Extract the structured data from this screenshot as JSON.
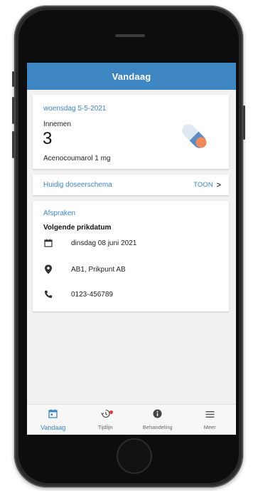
{
  "app": {
    "title": "Vandaag",
    "accent_color": "#3e86c1"
  },
  "today_card": {
    "date": "woensdag 5-5-2021",
    "take_label": "Innemen",
    "dose_count": "3",
    "medication": "Acenocoumarol 1 mg",
    "icon": "pill-capsule-icon"
  },
  "schema_card": {
    "label": "Huidig doseerschema",
    "action": "TOON",
    "chevron": ">"
  },
  "appointments_card": {
    "title": "Afspraken",
    "next_label": "Volgende prikdatum",
    "rows": [
      {
        "icon": "calendar-icon",
        "text": "dinsdag 08 juni 2021"
      },
      {
        "icon": "location-pin-icon",
        "text": "AB1, Prikpunt AB"
      },
      {
        "icon": "phone-icon",
        "text": "0123-456789"
      }
    ]
  },
  "bottom_nav": {
    "items": [
      {
        "label": "Vandaag",
        "icon": "calendar-icon",
        "active": true
      },
      {
        "label": "Tijdlijn",
        "icon": "history-icon",
        "active": false,
        "badge": true
      },
      {
        "label": "Behandeling",
        "icon": "info-icon",
        "active": false
      },
      {
        "label": "Meer",
        "icon": "menu-icon",
        "active": false
      }
    ]
  }
}
